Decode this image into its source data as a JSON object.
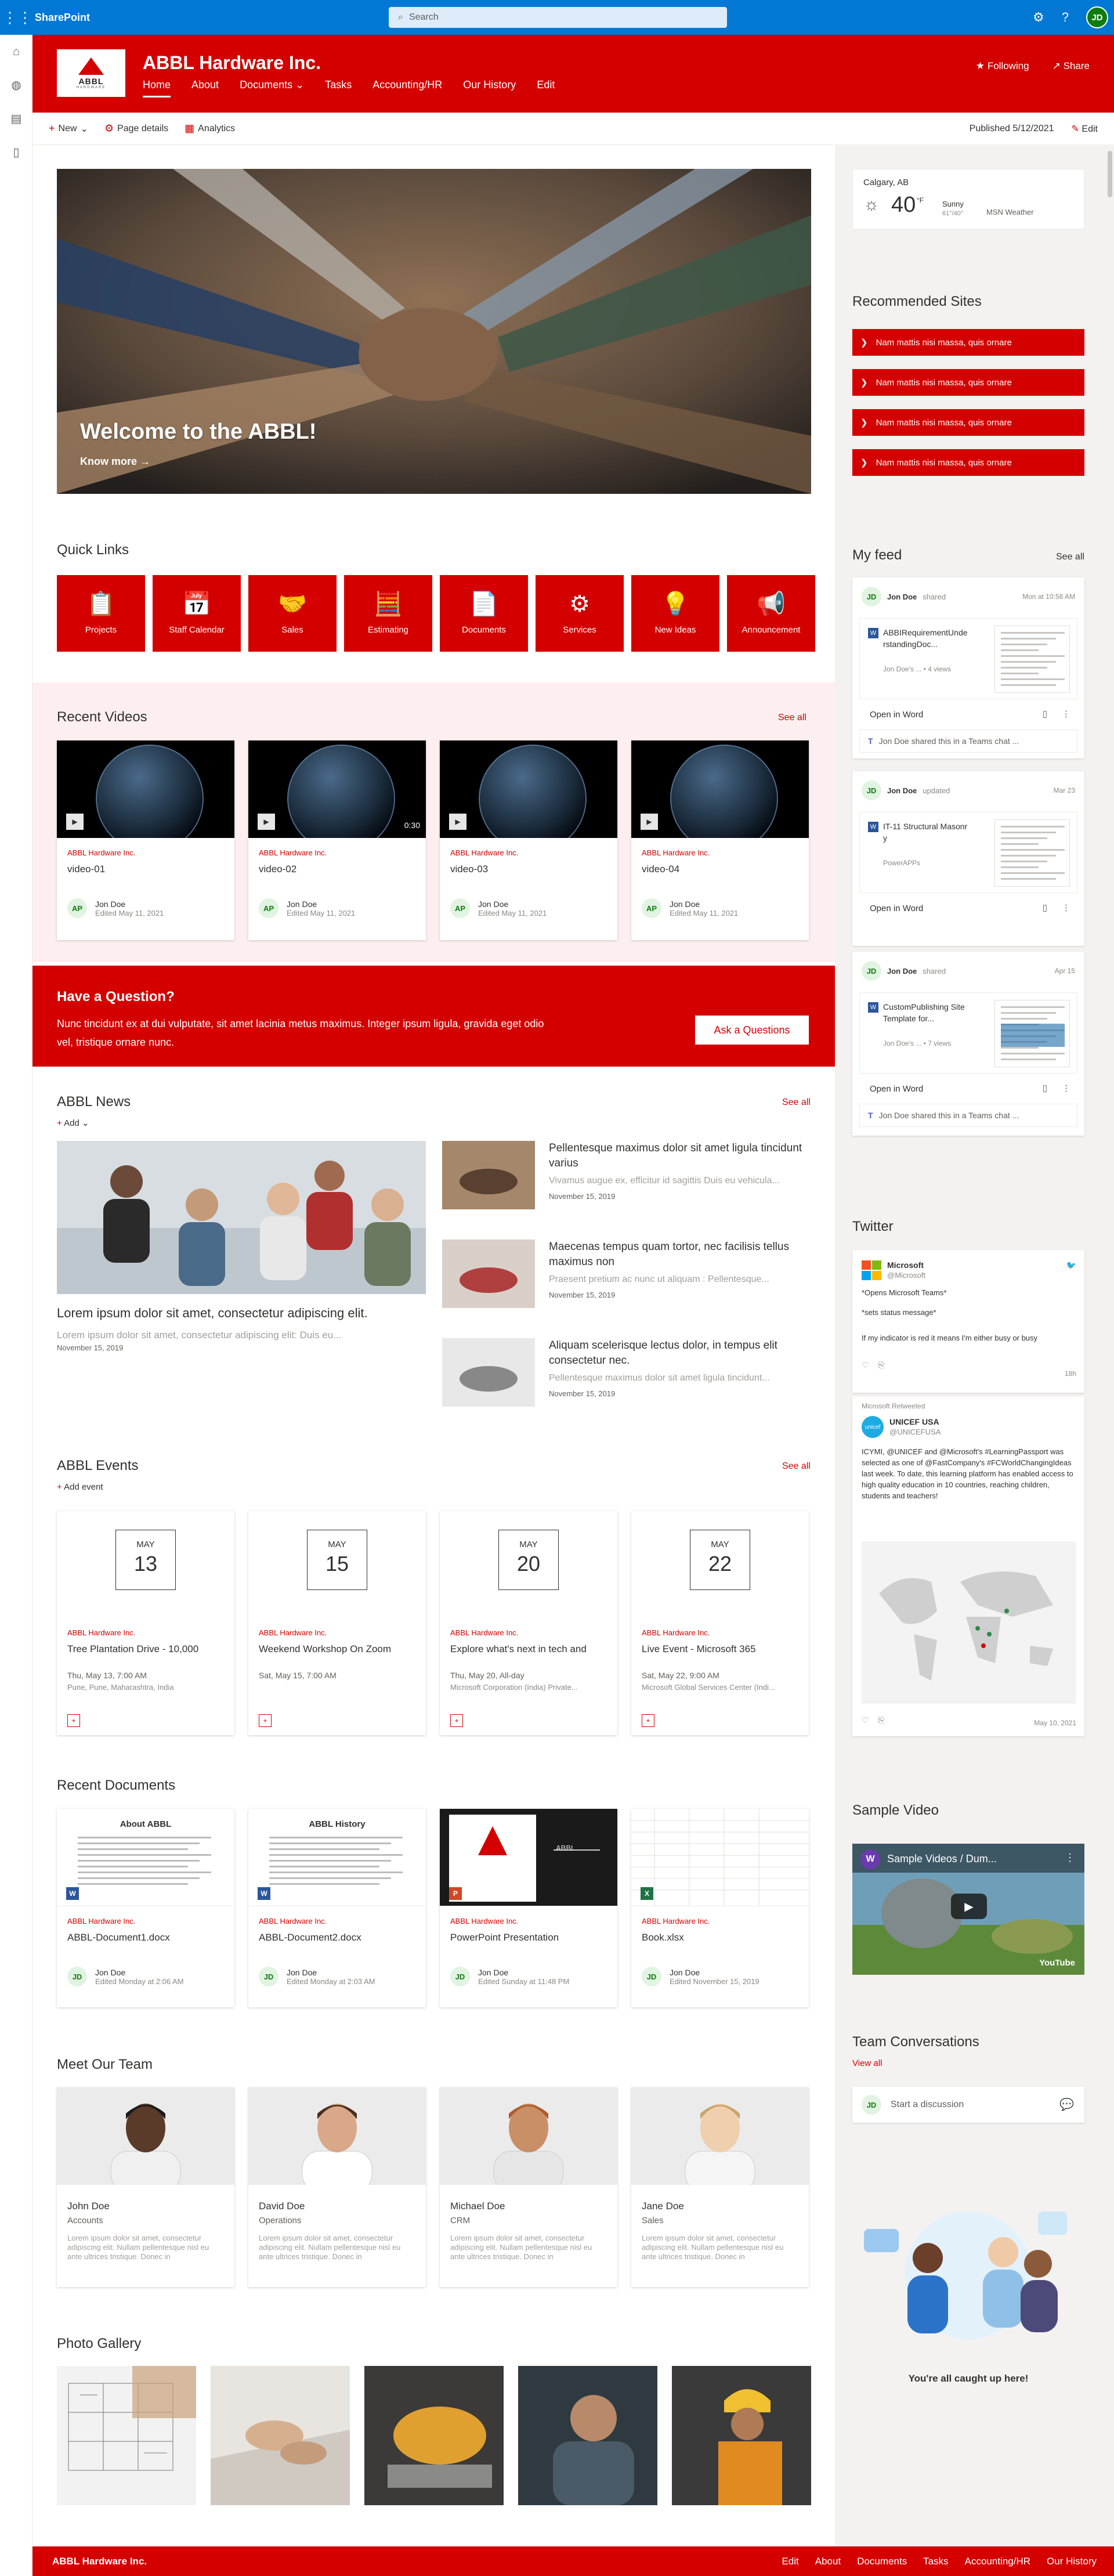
{
  "suite": {
    "brand": "SharePoint",
    "search_placeholder": "Search",
    "user_initials": "JD"
  },
  "site": {
    "title": "ABBL Hardware Inc.",
    "logo_text": "ABBL",
    "logo_sub": "HARDWARE",
    "nav": [
      "Home",
      "About",
      "Documents",
      "Tasks",
      "Accounting/HR",
      "Our History",
      "Edit"
    ],
    "following": "Following",
    "share": "Share"
  },
  "cmd": {
    "new": "New",
    "page_details": "Page details",
    "analytics": "Analytics",
    "published": "Published 5/12/2021",
    "edit": "Edit"
  },
  "hero": {
    "title": "Welcome to the ABBL!",
    "link": "Know more"
  },
  "quicklinks": {
    "title": "Quick Links",
    "items": [
      {
        "label": "Projects",
        "icon": "📋"
      },
      {
        "label": "Staff Calendar",
        "icon": "📅"
      },
      {
        "label": "Sales",
        "icon": "🤝"
      },
      {
        "label": "Estimating",
        "icon": "🧮"
      },
      {
        "label": "Documents",
        "icon": "📄"
      },
      {
        "label": "Services",
        "icon": "⚙"
      },
      {
        "label": "New Ideas",
        "icon": "💡"
      },
      {
        "label": "Announcement",
        "icon": "📢"
      }
    ]
  },
  "videos": {
    "title": "Recent Videos",
    "see_all": "See all",
    "items": [
      {
        "source": "ABBL Hardware Inc.",
        "title": "video-01",
        "duration": "",
        "author": "Jon Doe",
        "date": "Edited May 11, 2021",
        "initials": "AP"
      },
      {
        "source": "ABBL Hardware Inc.",
        "title": "video-02",
        "duration": "0:30",
        "author": "Jon Doe",
        "date": "Edited May 11, 2021",
        "initials": "AP"
      },
      {
        "source": "ABBL Hardware Inc.",
        "title": "video-03",
        "duration": "",
        "author": "Jon Doe",
        "date": "Edited May 11, 2021",
        "initials": "AP"
      },
      {
        "source": "ABBL Hardware Inc.",
        "title": "video-04",
        "duration": "",
        "author": "Jon Doe",
        "date": "Edited May 11, 2021",
        "initials": "AP"
      }
    ]
  },
  "question": {
    "title": "Have a Question?",
    "body": "Nunc tincidunt ex at dui vulputate, sit amet lacinia metus maximus. Integer ipsum ligula, gravida eget odio vel, tristique ornare nunc.",
    "button": "Ask a Questions"
  },
  "news": {
    "title": "ABBL News",
    "see_all": "See all",
    "add": "Add",
    "main": {
      "title": "Lorem ipsum dolor sit amet, consectetur adipiscing elit.",
      "desc": "Lorem ipsum dolor sit amet, consectetur adipiscing elit: Duis eu...",
      "date": "November 15, 2019"
    },
    "items": [
      {
        "title": "Pellentesque maximus dolor sit amet ligula tincidunt varius",
        "desc": "Vivamus augue ex, efficitur id sagittis Duis eu vehicula...",
        "date": "November 15, 2019"
      },
      {
        "title": "Maecenas tempus quam tortor, nec facilisis tellus maximus non",
        "desc": "Praesent pretium ac nunc ut aliquam : Pellentesque...",
        "date": "November 15, 2019"
      },
      {
        "title": "Aliquam scelerisque lectus dolor, in tempus elit consectetur nec.",
        "desc": "Pellentesque maximus dolor sit amet ligula tincidunt...",
        "date": "November 15, 2019"
      }
    ]
  },
  "events": {
    "title": "ABBL Events",
    "see_all": "See all",
    "add": "Add event",
    "items": [
      {
        "month": "MAY",
        "day": "13",
        "source": "ABBL Hardware Inc.",
        "title": "Tree Plantation Drive - 10,000",
        "when": "Thu, May 13, 7:00 AM",
        "where": "Pune, Pune, Maharashtra, India"
      },
      {
        "month": "MAY",
        "day": "15",
        "source": "ABBL Hardware Inc.",
        "title": "Weekend Workshop On Zoom",
        "when": "Sat, May 15, 7:00 AM",
        "where": ""
      },
      {
        "month": "MAY",
        "day": "20",
        "source": "ABBL Hardware Inc.",
        "title": "Explore what's next in tech and",
        "when": "Thu, May 20, All-day",
        "where": "Microsoft Corporation (India) Private..."
      },
      {
        "month": "MAY",
        "day": "22",
        "source": "ABBL Hardware Inc.",
        "title": "Live Event - Microsoft 365",
        "when": "Sat, May 22, 9:00 AM",
        "where": "Microsoft Global Services Center (Indi..."
      }
    ]
  },
  "documents": {
    "title": "Recent Documents",
    "items": [
      {
        "source": "ABBL Hardware Inc.",
        "title": "ABBL-Document1.docx",
        "doc_heading": "About ABBL",
        "author": "Jon Doe",
        "date": "Edited Monday at 2:06 AM",
        "initials": "JD",
        "type": "W"
      },
      {
        "source": "ABBL Hardware Inc.",
        "title": "ABBL-Document2.docx",
        "doc_heading": "ABBL History",
        "author": "Jon Doe",
        "date": "Edited Monday at 2:03 AM",
        "initials": "JD",
        "type": "W"
      },
      {
        "source": "ABBL Hardware Inc.",
        "title": "PowerPoint Presentation",
        "doc_heading": "ABBL",
        "author": "Jon Doe",
        "date": "Edited Sunday at 11:48 PM",
        "initials": "JD",
        "type": "P"
      },
      {
        "source": "ABBL Hardware Inc.",
        "title": "Book.xlsx",
        "doc_heading": "",
        "author": "Jon Doe",
        "date": "Edited November 15, 2019",
        "initials": "JD",
        "type": "X"
      }
    ]
  },
  "team": {
    "title": "Meet Our Team",
    "items": [
      {
        "name": "John Doe",
        "role": "Accounts",
        "desc": "Lorem ipsum dolor sit amet, consectetur adipiscing elit. Nullam pellentesque nisl eu ante ultrices tristique. Donec in"
      },
      {
        "name": "David Doe",
        "role": "Operations",
        "desc": "Lorem ipsum dolor sit amet, consectetur adipiscing elit. Nullam pellentesque nisl eu ante ultrices tristique. Donec in"
      },
      {
        "name": "Michael Doe",
        "role": "CRM",
        "desc": "Lorem ipsum dolor sit amet, consectetur adipiscing elit. Nullam pellentesque nisl eu ante ultrices tristique. Donec in"
      },
      {
        "name": "Jane Doe",
        "role": "Sales",
        "desc": "Lorem ipsum dolor sit amet, consectetur adipiscing elit. Nullam pellentesque nisl eu ante ultrices tristique. Donec in"
      }
    ]
  },
  "gallery": {
    "title": "Photo Gallery"
  },
  "weather": {
    "city": "Calgary, AB",
    "temp": "40",
    "unit": "°F",
    "condition": "Sunny",
    "range": "61°/40°",
    "provider": "MSN Weather"
  },
  "recommended": {
    "title": "Recommended Sites",
    "items": [
      "Nam mattis nisi massa, quis ornare",
      "Nam mattis nisi massa, quis ornare",
      "Nam mattis nisi massa, quis ornare",
      "Nam mattis nisi massa, quis ornare"
    ]
  },
  "feed": {
    "title": "My feed",
    "see_all": "See all",
    "open": "Open in Word",
    "items": [
      {
        "who": "Jon Doe",
        "action": "shared",
        "when": "Mon at 10:56 AM",
        "doc": "ABBIRequirementUnderstandingDoc...",
        "meta": "Jon Doe's ... • 4 views",
        "teams": "Jon Doe shared this in a Teams chat ..."
      },
      {
        "who": "Jon Doe",
        "action": "updated",
        "when": "Mar 23",
        "doc": "IT-11 Structural Masonry",
        "meta": "PowerAPPs",
        "teams": ""
      },
      {
        "who": "Jon Doe",
        "action": "shared",
        "when": "Apr 15",
        "doc": "CustomPublishing Site Template for...",
        "meta": "Jon Doe's ... • 7 views",
        "teams": "Jon Doe shared this in a Teams chat ..."
      }
    ]
  },
  "twitter": {
    "title": "Twitter",
    "t1": {
      "name": "Microsoft",
      "handle": "@Microsoft",
      "l1": "*Opens Microsoft Teams*",
      "l2": "*sets status message*",
      "l3": "If my indicator is red it means I'm either busy or busy",
      "age": "18h"
    },
    "retweet": "Microsoft Retweeted",
    "t2": {
      "name": "UNICEF USA",
      "handle": "@UNICEFUSA",
      "body": "ICYMI, @UNICEF and @Microsoft's #LearningPassport was selected as one of @FastCompany's #FCWorldChangingIdeas last week. To date, this learning platform has enabled access to high quality education in 10 countries, reaching children, students and teachers!",
      "date": "May 10, 2021"
    }
  },
  "video": {
    "title": "Sample Video",
    "caption": "Sample Videos / Dum...",
    "badge": "W",
    "brand": "YouTube"
  },
  "conversations": {
    "title": "Team Conversations",
    "view_all": "View all",
    "placeholder": "Start a discussion",
    "initials": "JD",
    "caught_up": "You're all caught up here!"
  },
  "footer": {
    "brand": "ABBL Hardware Inc.",
    "links": [
      "Edit",
      "About",
      "Documents",
      "Tasks",
      "Accounting/HR",
      "Our History"
    ]
  },
  "colors": {
    "brand": "#d40000",
    "suite": "#0078d4"
  }
}
